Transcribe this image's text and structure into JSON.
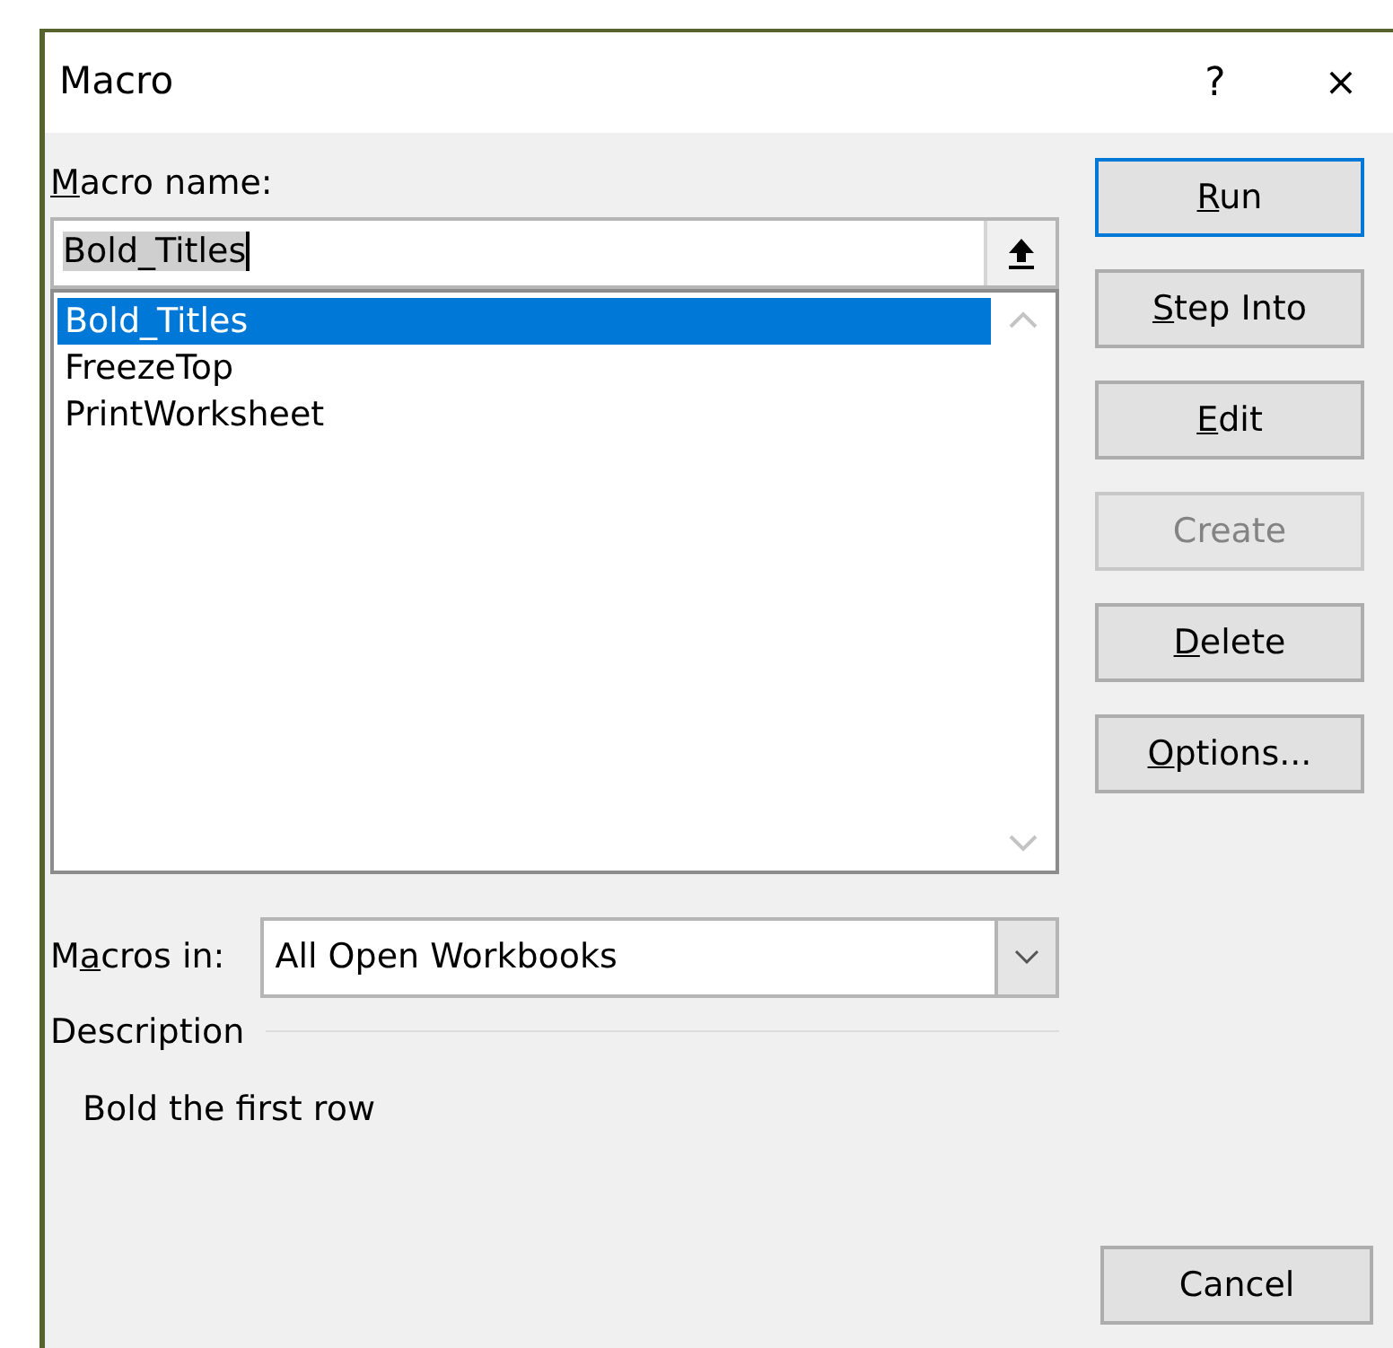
{
  "window": {
    "title": "Macro",
    "help": "?",
    "close": "×"
  },
  "macro_name": {
    "label": {
      "key": "M",
      "post": "acro name:"
    },
    "value": "Bold_Titles"
  },
  "macros": [
    {
      "name": "Bold_Titles",
      "selected": true
    },
    {
      "name": "FreezeTop",
      "selected": false
    },
    {
      "name": "PrintWorksheet",
      "selected": false
    }
  ],
  "macros_in": {
    "label": {
      "pre": "M",
      "key": "a",
      "post": "cros in:"
    },
    "value": "All Open Workbooks"
  },
  "description": {
    "heading": "Description",
    "text": "Bold the first row"
  },
  "buttons": [
    {
      "label": {
        "key": "R",
        "post": "un"
      },
      "disabled": false,
      "default": true
    },
    {
      "label": {
        "key": "S",
        "post": "tep Into"
      },
      "disabled": false,
      "default": false
    },
    {
      "label": {
        "key": "E",
        "post": "dit"
      },
      "disabled": false,
      "default": false
    },
    {
      "label": {
        "pre": "Create"
      },
      "disabled": true,
      "default": false
    },
    {
      "label": {
        "key": "D",
        "post": "elete"
      },
      "disabled": false,
      "default": false
    },
    {
      "label": {
        "key": "O",
        "post": "ptions..."
      },
      "disabled": false,
      "default": false
    }
  ],
  "cancel": {
    "label": "Cancel"
  }
}
